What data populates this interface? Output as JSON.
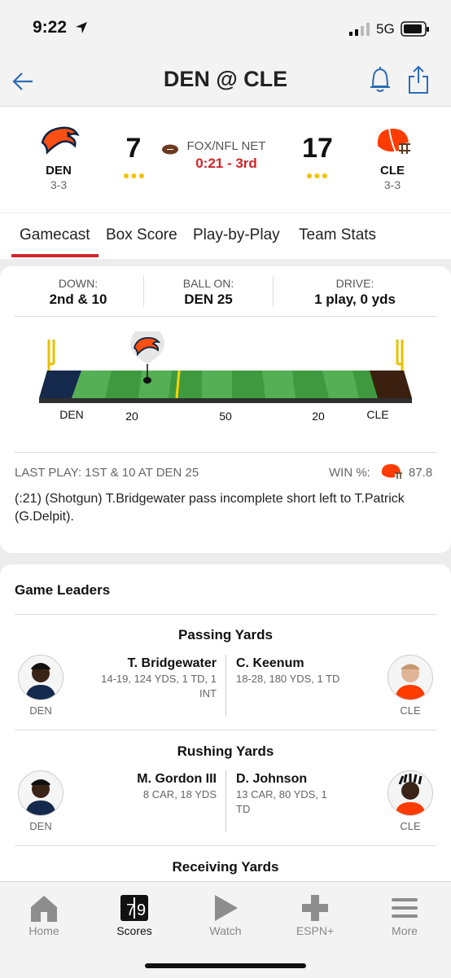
{
  "status": {
    "time": "9:22",
    "network": "5G"
  },
  "nav": {
    "title": "DEN @ CLE"
  },
  "game": {
    "away": {
      "abbr": "DEN",
      "record": "3-3",
      "score": "7"
    },
    "home": {
      "abbr": "CLE",
      "record": "3-3",
      "score": "17"
    },
    "network": "FOX/NFL NET",
    "clock": "0:21 - 3rd"
  },
  "tabs": [
    "Gamecast",
    "Box Score",
    "Play-by-Play",
    "Team Stats"
  ],
  "situation": {
    "down_label": "DOWN:",
    "down_value": "2nd & 10",
    "ball_label": "BALL ON:",
    "ball_value": "DEN 25",
    "drive_label": "DRIVE:",
    "drive_value": "1 play, 0 yds"
  },
  "field": {
    "left_team": "DEN",
    "right_team": "CLE",
    "yard_labels": [
      "20",
      "50",
      "20"
    ]
  },
  "last_play": {
    "header": "LAST PLAY: 1ST & 10 AT DEN 25",
    "win_label": "WIN %:",
    "win_value": "87.8",
    "text": "(:21) (Shotgun) T.Bridgewater pass incomplete short left to T.Patrick (G.Delpit)."
  },
  "leaders": {
    "title": "Game Leaders",
    "passing": {
      "title": "Passing Yards",
      "away": {
        "name": "T. Bridgewater",
        "stat": "14-19, 124 YDS, 1 TD, 1 INT",
        "team": "DEN"
      },
      "home": {
        "name": "C. Keenum",
        "stat": "18-28, 180 YDS, 1 TD",
        "team": "CLE"
      }
    },
    "rushing": {
      "title": "Rushing Yards",
      "away": {
        "name": "M. Gordon III",
        "stat": "8 CAR, 18 YDS",
        "team": "DEN"
      },
      "home": {
        "name": "D. Johnson",
        "stat": "13 CAR, 80 YDS, 1 TD",
        "team": "CLE"
      }
    },
    "receiving": {
      "title": "Receiving Yards"
    }
  },
  "bottom_nav": [
    "Home",
    "Scores",
    "Watch",
    "ESPN+",
    "More"
  ],
  "colors": {
    "accent": "#d2232a",
    "den_endzone": "#14294b",
    "cle_endzone": "#3b2010",
    "field": "#4caf50"
  }
}
